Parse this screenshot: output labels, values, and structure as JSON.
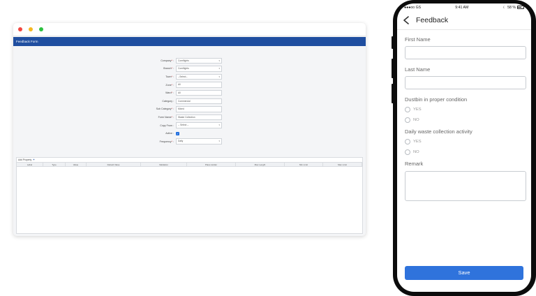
{
  "desktop": {
    "header_title": "Feedback Form",
    "fields": [
      {
        "label": "Company",
        "required": true,
        "type": "select",
        "value": "Cornflights"
      },
      {
        "label": "Branch",
        "required": true,
        "type": "select",
        "value": "Cornflights"
      },
      {
        "label": "Town",
        "required": true,
        "type": "select",
        "value": "--Select--"
      },
      {
        "label": "Zone",
        "required": true,
        "type": "text",
        "value": "All"
      },
      {
        "label": "Ward",
        "required": true,
        "type": "text",
        "value": "All"
      },
      {
        "label": "Category",
        "required": false,
        "type": "text",
        "value": "Commercial"
      },
      {
        "label": "Sub Category",
        "required": true,
        "type": "text",
        "value": "Mixed"
      },
      {
        "label": "Form Name",
        "required": true,
        "type": "text",
        "value": "Waste Collection"
      },
      {
        "label": "Copy From",
        "required": false,
        "type": "select",
        "value": "-- Select --"
      },
      {
        "label": "Active",
        "required": false,
        "type": "checkbox",
        "value": "✓"
      },
      {
        "label": "Frequency",
        "required": true,
        "type": "select",
        "value": "Daily"
      }
    ],
    "add_property": "Add Property",
    "table_columns": [
      "Label",
      "Type",
      "Value",
      "Default Value",
      "Validation",
      "Place Holder",
      "Max Length",
      "Min Limit",
      "Max Limit"
    ]
  },
  "phone": {
    "status": {
      "carrier": "●●●oo GS",
      "time": "9:41 AM",
      "battery_text": "58 %",
      "battery_level": 0.58
    },
    "nav_title": "Feedback",
    "first_name_label": "First Name",
    "last_name_label": "Last Name",
    "q1_label": "Dustbin in proper condition",
    "q2_label": "Daily waste collection activity",
    "yes": "YES",
    "no": "NO",
    "remark_label": "Remark",
    "save_label": "Save"
  },
  "colors": {
    "header": "#1f4ea0",
    "save": "#2f73dc"
  }
}
